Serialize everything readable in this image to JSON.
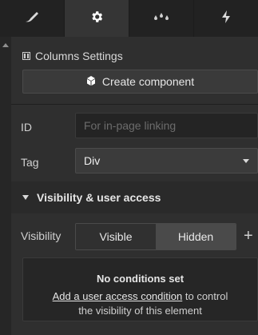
{
  "tabs": [
    {
      "icon": "brush-icon"
    },
    {
      "icon": "gear-icon"
    },
    {
      "icon": "droplets-icon"
    },
    {
      "icon": "lightning-icon"
    }
  ],
  "section": {
    "title": "Columns Settings",
    "create_component_label": "Create component"
  },
  "fields": {
    "id_label": "ID",
    "id_placeholder": "For in-page linking",
    "tag_label": "Tag",
    "tag_value": "Div"
  },
  "visibility": {
    "section_title": "Visibility & user access",
    "label": "Visibility",
    "options": [
      "Visible",
      "Hidden"
    ],
    "conditions_title": "No conditions set",
    "conditions_link": "Add a user access condition",
    "conditions_rest": " to control",
    "conditions_line2": "the visibility of this element"
  }
}
